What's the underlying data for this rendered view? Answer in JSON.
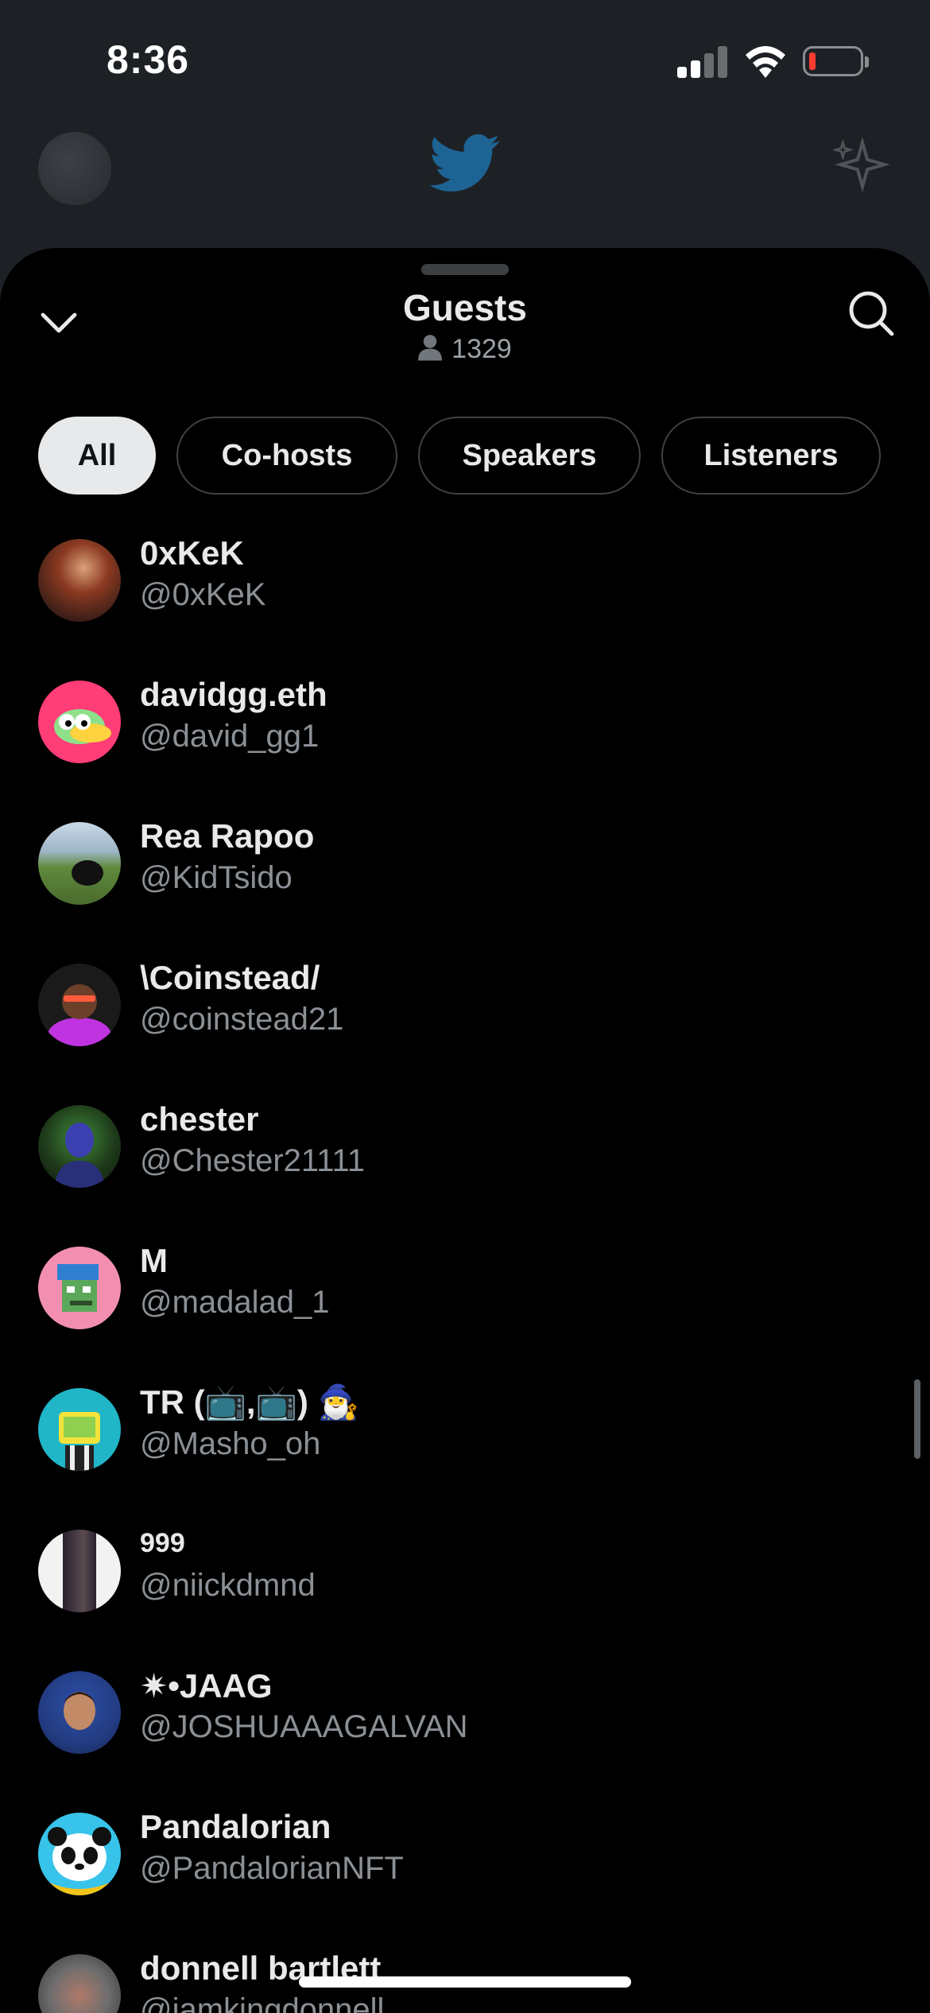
{
  "status_bar": {
    "time": "8:36"
  },
  "sheet": {
    "title": "Guests",
    "listener_count": "1329"
  },
  "filters": [
    {
      "label": "All",
      "active": true
    },
    {
      "label": "Co-hosts",
      "active": false
    },
    {
      "label": "Speakers",
      "active": false
    },
    {
      "label": "Listeners",
      "active": false
    }
  ],
  "guests": [
    {
      "name": "0xKeK",
      "handle": "@0xKeK",
      "avatar_color": "#7a2c1e"
    },
    {
      "name": "davidgg.eth",
      "handle": "@david_gg1",
      "avatar_color": "#ff3d77"
    },
    {
      "name": "Rea Rapoo",
      "handle": "@KidTsido",
      "avatar_color": "#6b8f4a"
    },
    {
      "name": "\\Coinstead/",
      "handle": "@coinstead21",
      "avatar_color": "#8a2be2"
    },
    {
      "name": "chester",
      "handle": "@Chester21111",
      "avatar_color": "#3a3f9a"
    },
    {
      "name": "M",
      "handle": "@madalad_1",
      "avatar_color": "#f28fb0"
    },
    {
      "name": "TR (📺,📺) 🧙‍♂️",
      "handle": "@Masho_oh",
      "avatar_color": "#20b6c8"
    },
    {
      "name": "999",
      "handle": "@niickdmnd",
      "avatar_color": "#f2f2f2"
    },
    {
      "name": "✷•JAAG",
      "handle": "@JOSHUAAAGALVAN",
      "avatar_color": "#3a5aa8"
    },
    {
      "name": "Pandalorian",
      "handle": "@PandalorianNFT",
      "avatar_color": "#38c3ea"
    },
    {
      "name": "donnell bartlett",
      "handle": "@iamkingdonnell",
      "avatar_color": "#6d6d6d"
    }
  ]
}
